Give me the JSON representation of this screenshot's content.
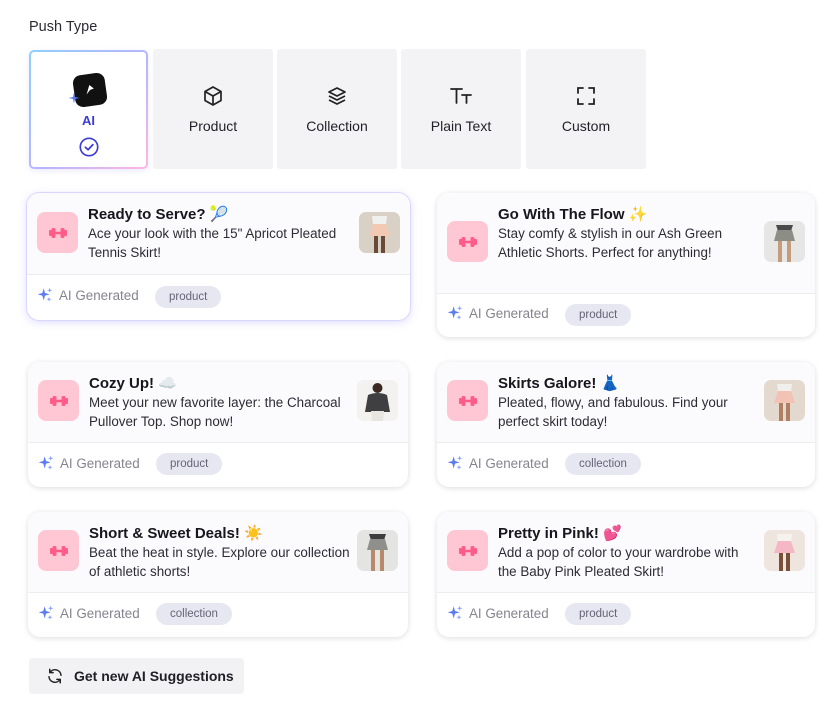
{
  "push_type": {
    "label": "Push Type",
    "options": [
      {
        "label": "AI",
        "icon": "ai-logo-icon",
        "selected": true
      },
      {
        "label": "Product",
        "icon": "cube-icon"
      },
      {
        "label": "Collection",
        "icon": "layers-icon"
      },
      {
        "label": "Plain Text",
        "icon": "text-size-icon"
      },
      {
        "label": "Custom",
        "icon": "frame-corners-icon"
      }
    ]
  },
  "suggestions": [
    {
      "title": "Ready to Serve? 🎾",
      "body": "Ace your look with the 15\" Apricot Pleated Tennis Skirt!",
      "ai_label": "AI Generated",
      "tag": "product",
      "image": "apricot-skirt-image",
      "selected": true
    },
    {
      "title": "Go With The Flow ✨",
      "body": "Stay comfy & stylish in our Ash Green Athletic Shorts. Perfect for anything!",
      "ai_label": "AI Generated",
      "tag": "product",
      "image": "green-shorts-image"
    },
    {
      "title": "Cozy Up! ☁️",
      "body": "Meet your new favorite layer: the Charcoal Pullover Top. Shop now!",
      "ai_label": "AI Generated",
      "tag": "product",
      "image": "pullover-top-image"
    },
    {
      "title": "Skirts Galore! 👗",
      "body": "Pleated, flowy, and fabulous. Find your perfect skirt today!",
      "ai_label": "AI Generated",
      "tag": "collection",
      "image": "skirt-collection-image"
    },
    {
      "title": "Short & Sweet Deals! ☀️",
      "body": "Beat the heat in style. Explore our collection of athletic shorts!",
      "ai_label": "AI Generated",
      "tag": "collection",
      "image": "shorts-collection-image"
    },
    {
      "title": "Pretty in Pink! 💕",
      "body": "Add a pop of color to your wardrobe with the Baby Pink Pleated Skirt!",
      "ai_label": "AI Generated",
      "tag": "product",
      "image": "pink-skirt-image"
    }
  ],
  "refresh_button": {
    "label": "Get new AI Suggestions",
    "icon": "refresh-icon"
  },
  "colors": {
    "accent": "#3b3bd6",
    "thumb_bg": "#ffc7d4",
    "tag_bg": "#e7e7f1"
  }
}
